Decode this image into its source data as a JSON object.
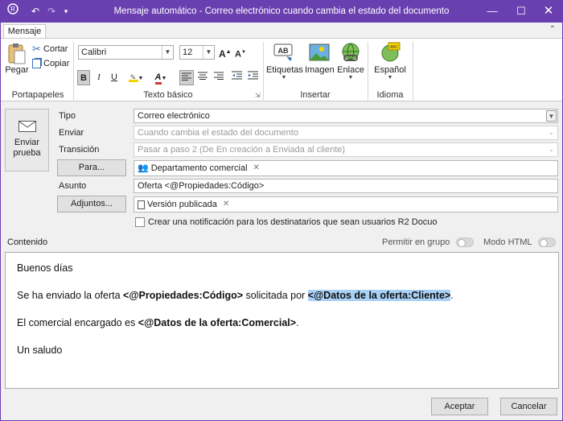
{
  "window": {
    "title": "Mensaje automático - Correo electrónico cuando cambia el estado del documento"
  },
  "ribbon": {
    "tab": "Mensaje",
    "groups": {
      "clipboard": "Portapapeles",
      "basic_text": "Texto básico",
      "insert": "Insertar",
      "language": "Idioma"
    },
    "paste": "Pegar",
    "cut": "Cortar",
    "copy": "Copiar",
    "font": "Calibri",
    "font_size": "12",
    "bold": "B",
    "italic": "I",
    "underline": "U",
    "labels": "Etiquetas",
    "image": "Imagen",
    "link": "Enlace",
    "language_btn": "Español"
  },
  "form": {
    "send_test": "Enviar prueba",
    "type_label": "Tipo",
    "type_value": "Correo electrónico",
    "send_label": "Enviar",
    "send_value": "Cuando cambia el estado del documento",
    "transition_label": "Transición",
    "transition_value": "Pasar a paso 2 (De En creación a Enviada al cliente)",
    "to_button": "Para...",
    "to_recipient": "Departamento comercial",
    "subject_label": "Asunto",
    "subject_value": "Oferta <@Propiedades:Código>",
    "attachments_button": "Adjuntos...",
    "attachment": "Versión publicada",
    "notify_checkbox": "Crear una notificación para los destinatarios que sean usuarios R2 Docuo"
  },
  "content": {
    "label": "Contenido",
    "allow_group": "Permitir en grupo",
    "html_mode": "Modo HTML",
    "greeting": "Buenos días",
    "line2_pre": "Se ha enviado la oferta ",
    "line2_tag1": "<@Propiedades:Código>",
    "line2_mid": " solicitada por ",
    "line2_tag2": "<@Datos de la oferta:Cliente>",
    "line2_end": ".",
    "line3_pre": "El comercial encargado es ",
    "line3_tag": "<@Datos de la oferta:Comercial>",
    "line3_end": ".",
    "closing": "Un saludo"
  },
  "footer": {
    "accept": "Aceptar",
    "cancel": "Cancelar"
  }
}
